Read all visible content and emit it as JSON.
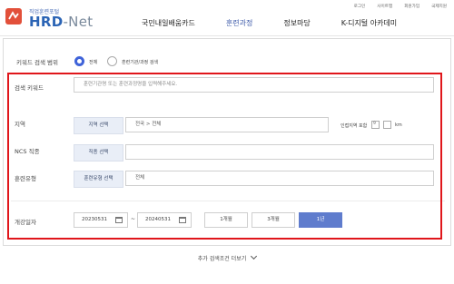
{
  "header": {
    "logo_small": "직업훈련포털",
    "logo_main": "HRD",
    "logo_sub": "-Net",
    "util": [
      "로그인",
      "사이트맵",
      "회원가입",
      "국제지원"
    ],
    "gnb": [
      {
        "label": "국민내일배움카드",
        "active": false
      },
      {
        "label": "훈련과정",
        "active": true
      },
      {
        "label": "정보마당",
        "active": false
      },
      {
        "label": "K-디지털 아카데미",
        "active": false
      }
    ]
  },
  "search": {
    "keyword_range_label": "키워드 검색 범위",
    "radio_all": "전체",
    "radio_course": "훈련기관/과정 검색",
    "keyword_label": "검색 키워드",
    "keyword_placeholder": "훈련기관명 또는 훈련과정명을 입력해주세요.",
    "region_label": "지역",
    "region_button": "지역 선택",
    "region_value": "전국 > 전체",
    "nearby_label": "인접지역 포함",
    "nearby_number": "9",
    "nearby_unit": "km",
    "ncs_label": "NCS 직종",
    "ncs_button": "직종 선택",
    "ncs_value": "",
    "type_label": "훈련유형",
    "type_button": "훈련유형 선택",
    "type_value": "전체",
    "period_label": "개강일자",
    "start_date": "20230531",
    "end_date": "20240531",
    "tilde": "~",
    "periods": [
      {
        "label": "1개월",
        "active": false
      },
      {
        "label": "3개월",
        "active": false
      },
      {
        "label": "1년",
        "active": true
      }
    ],
    "more_label": "추가 검색조건 더보기"
  },
  "colors": {
    "accent": "#3e5ba9",
    "highlight": "#e0161b",
    "active_button": "#5f7ccd"
  }
}
